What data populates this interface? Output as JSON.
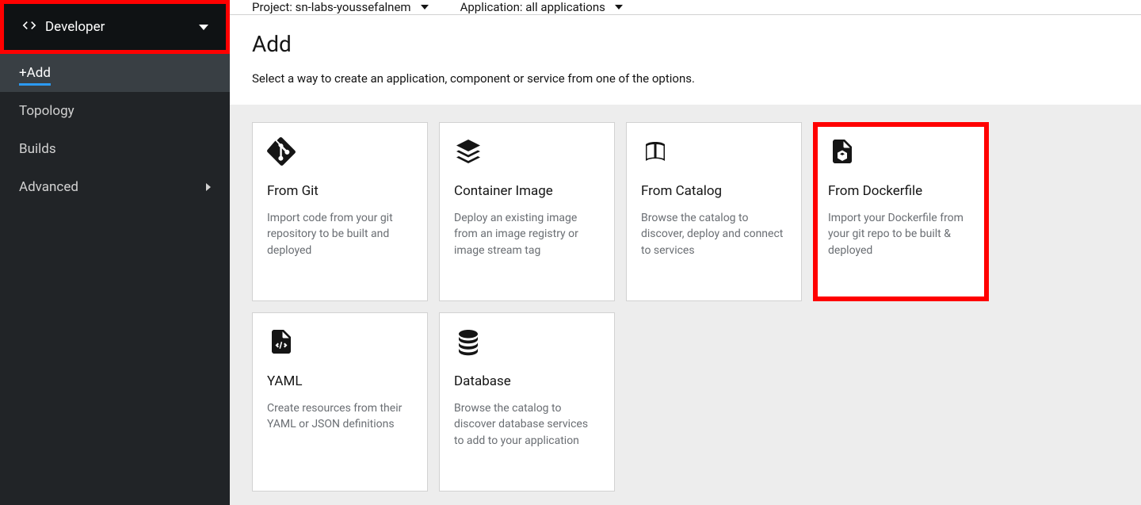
{
  "sidebar": {
    "perspective_label": "Developer",
    "nav": {
      "add": "+Add",
      "topology": "Topology",
      "builds": "Builds",
      "advanced": "Advanced"
    }
  },
  "toolbar": {
    "project_prefix": "Project: ",
    "project_value": "sn-labs-youssefalnem",
    "application_prefix": "Application: ",
    "application_value": "all applications"
  },
  "header": {
    "title": "Add",
    "description": "Select a way to create an application, component or service from one of the options."
  },
  "cards": {
    "from_git": {
      "title": "From Git",
      "desc": "Import code from your git repository to be built and deployed"
    },
    "container_image": {
      "title": "Container Image",
      "desc": "Deploy an existing image from an image registry or image stream tag"
    },
    "from_catalog": {
      "title": "From Catalog",
      "desc": "Browse the catalog to discover, deploy and connect to services"
    },
    "from_dockerfile": {
      "title": "From Dockerfile",
      "desc": "Import your Dockerfile from your git repo to be built & deployed"
    },
    "yaml": {
      "title": "YAML",
      "desc": "Create resources from their YAML or JSON definitions"
    },
    "database": {
      "title": "Database",
      "desc": "Browse the catalog to discover database services to add to your application"
    }
  }
}
